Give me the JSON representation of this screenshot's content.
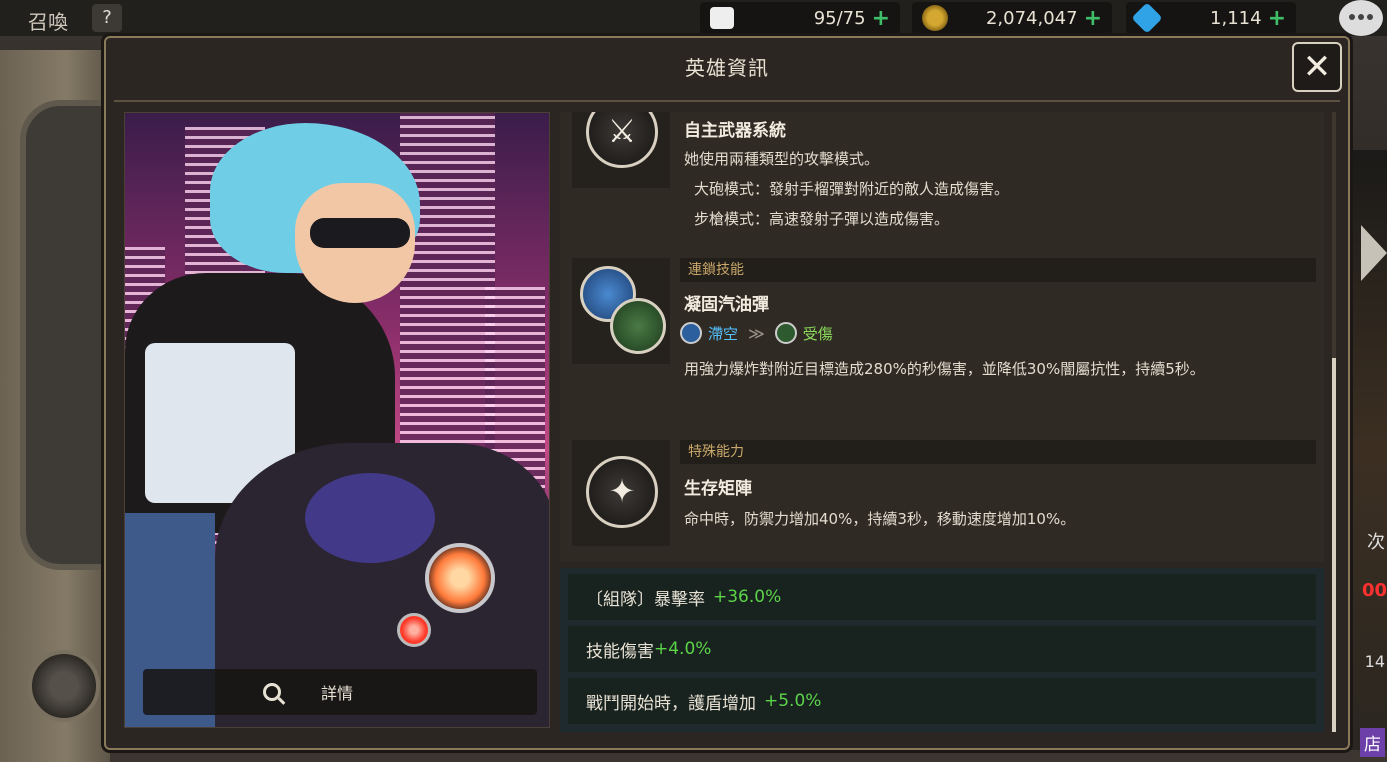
{
  "topbar": {
    "summon_label": "召喚",
    "help_label": "?",
    "stamina": "95/75",
    "gold": "2,074,047",
    "gems": "1,114",
    "plus": "+"
  },
  "background": {
    "right_text1": "次",
    "right_text2": "00",
    "right_text3": "14",
    "right_text4": "店"
  },
  "modal": {
    "title": "英雄資訊",
    "close_label": "✕",
    "details_label": "詳情"
  },
  "skills": {
    "weapon": {
      "icon_glyph": "⚔",
      "name": "自主武器系統",
      "desc1": "她使用兩種類型的攻擊模式。",
      "desc2": "大砲模式：發射手榴彈對附近的敵人造成傷害。",
      "desc3": "步槍模式：高速發射子彈以造成傷害。"
    },
    "chain": {
      "tag": "連鎖技能",
      "name": "凝固汽油彈",
      "from_label": "滯空",
      "to_label": "受傷",
      "arrow": "≫",
      "desc": "用強力爆炸對附近目標造成280%的秒傷害，並降低30%闇屬抗性，持續5秒。"
    },
    "special": {
      "tag": "特殊能力",
      "icon_glyph": "✦",
      "name": "生存矩陣",
      "desc": "命中時，防禦力增加40%，持續3秒，移動速度增加10%。"
    }
  },
  "stats": [
    {
      "label": "〔組隊〕暴擊率",
      "value": "+36.0%"
    },
    {
      "label": "技能傷害",
      "value": "+4.0%"
    },
    {
      "label": "戰鬥開始時，護盾增加",
      "value": "+5.0%"
    }
  ],
  "colors": {
    "positive": "#5bd448",
    "tag": "#c9a86a",
    "link_blue": "#55c2ff",
    "link_green": "#8cdc5c"
  }
}
